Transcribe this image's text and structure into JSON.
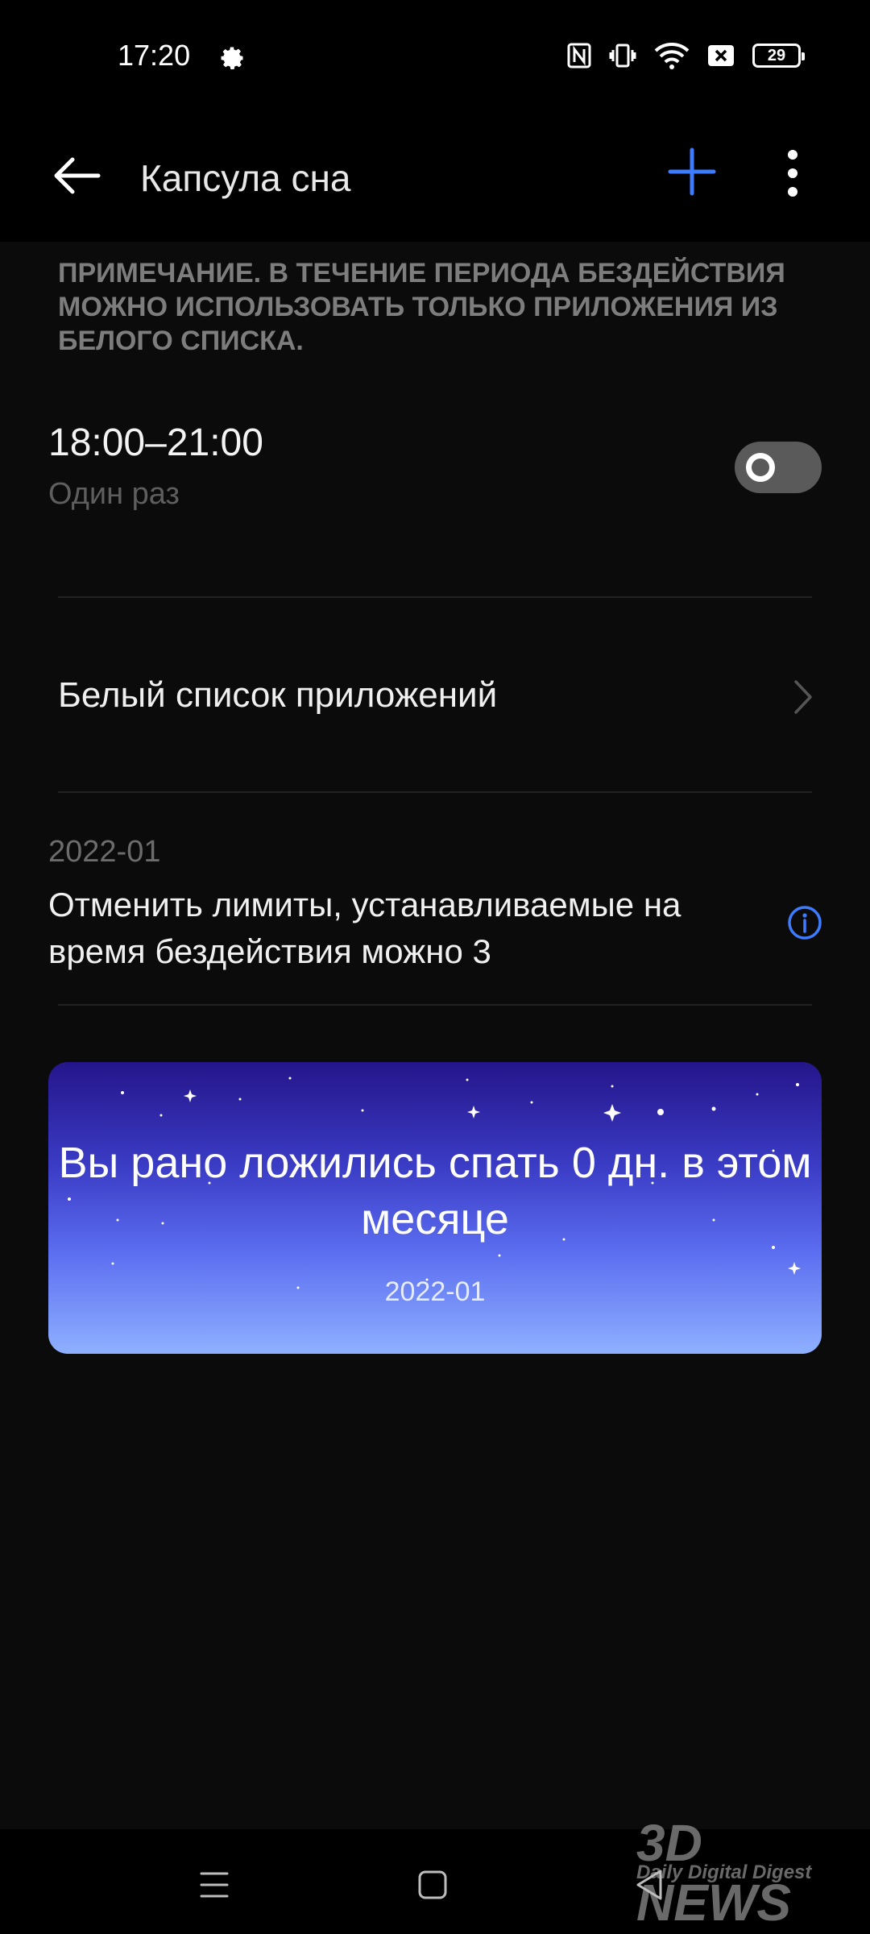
{
  "status_bar": {
    "time": "17:20",
    "battery": "29",
    "icons": [
      "gear-icon",
      "nfc-icon",
      "vibrate-icon",
      "wifi-icon",
      "sim-off-icon",
      "battery-icon"
    ]
  },
  "app_bar": {
    "title": "Капсула сна",
    "icons": [
      "arrow-left-icon",
      "plus-icon",
      "more-vertical-icon"
    ],
    "accent_color": "#3d7bff"
  },
  "note": "ПРИМЕЧАНИЕ. В ТЕЧЕНИЕ ПЕРИОДА БЕЗДЕЙСТВИЯ МОЖНО ИСПОЛЬЗОВАТЬ ТОЛЬКО ПРИЛОЖЕНИЯ ИЗ БЕЛОГО СПИСКА.",
  "schedule": {
    "time": "18:00–21:00",
    "repeat": "Один раз",
    "enabled": false
  },
  "whitelist": {
    "label": "Белый список приложений"
  },
  "limits": {
    "date": "2022-01",
    "text": "Отменить лимиты, устанавливаемые на время бездействия можно 3"
  },
  "card": {
    "text": "Вы рано ложились спать 0 дн. в этом месяце",
    "date": "2022-01"
  },
  "watermark": {
    "logo": "3D NEWS",
    "tagline": "Daily Digital Digest"
  }
}
